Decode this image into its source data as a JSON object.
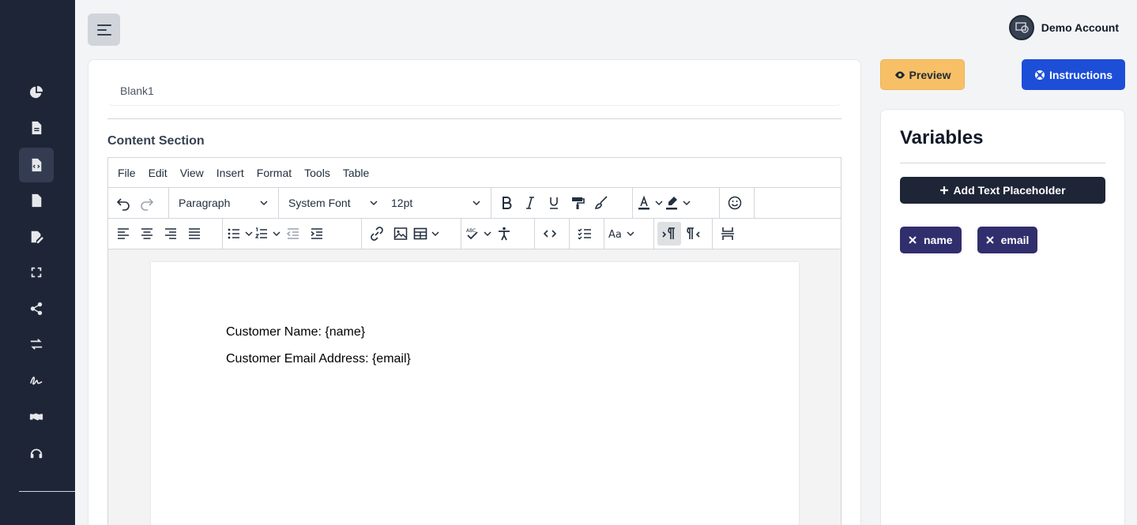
{
  "account": {
    "name": "Demo Account"
  },
  "document": {
    "title": "Blank1"
  },
  "content_section": {
    "label": "Content Section"
  },
  "editor": {
    "menu": [
      "File",
      "Edit",
      "View",
      "Insert",
      "Format",
      "Tools",
      "Table"
    ],
    "block_format": "Paragraph",
    "font_family": "System Font",
    "font_size": "12pt",
    "lines": [
      "Customer Name: {name}",
      "Customer Email Address: {email}"
    ]
  },
  "actions": {
    "preview_label": "Preview",
    "instructions_label": "Instructions"
  },
  "variables": {
    "title": "Variables",
    "add_label": "Add Text Placeholder",
    "items": [
      {
        "label": "name"
      },
      {
        "label": "email"
      }
    ]
  },
  "colors": {
    "sidebar_bg": "#1e2536",
    "preview_btn": "#f7c066",
    "instructions_btn": "#1d4ed8",
    "chip_bg": "#312e6e"
  },
  "icons": {
    "sidebar": [
      "pie-chart-icon",
      "document-icon",
      "code-file-icon",
      "file-icon",
      "signature-edit-icon",
      "expand-icon",
      "share-icon",
      "exchange-icon",
      "signature-icon",
      "handshake-icon",
      "headset-icon"
    ]
  }
}
